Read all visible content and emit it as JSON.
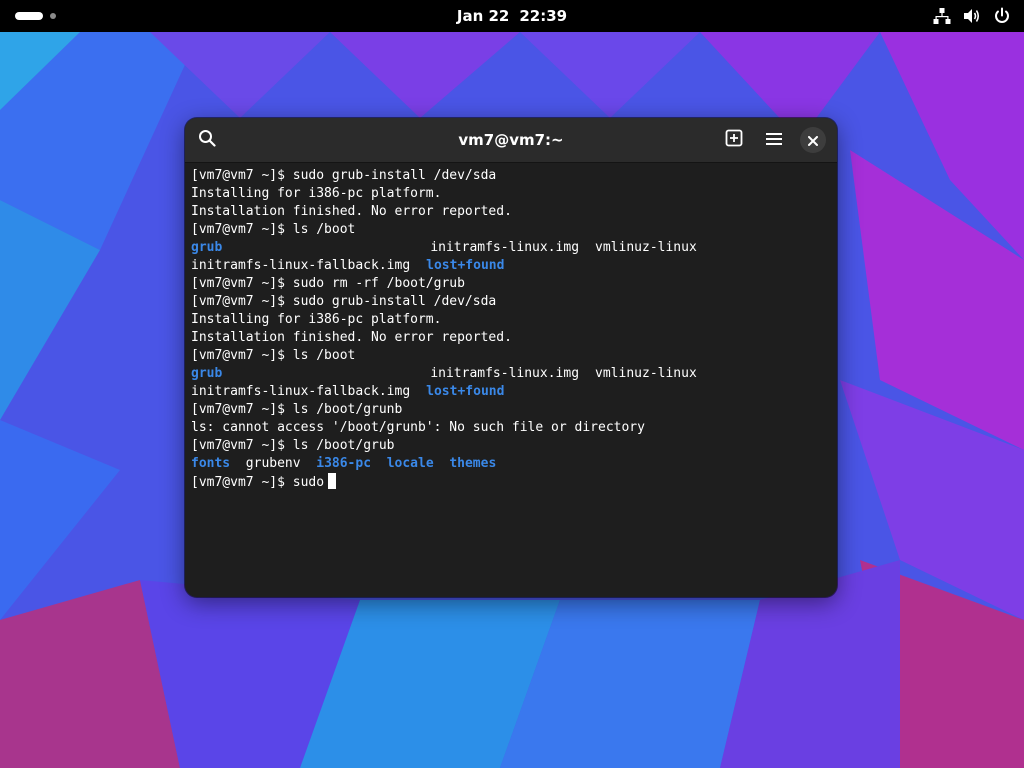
{
  "topbar": {
    "date": "Jan 22",
    "time": "22:39",
    "icons": [
      "activities-indicator",
      "network-icon",
      "volume-icon",
      "power-icon"
    ]
  },
  "terminal": {
    "title": "vm7@vm7:~",
    "colors": {
      "background": "#1e1e1e",
      "titlebar": "#2b2b2b",
      "text": "#ffffff",
      "directory": "#3a88e8"
    },
    "lines": [
      {
        "prompt": "[vm7@vm7 ~]$ ",
        "cmd": "sudo grub-install /dev/sda"
      },
      {
        "text": "Installing for i386-pc platform."
      },
      {
        "text": "Installation finished. No error reported."
      },
      {
        "prompt": "[vm7@vm7 ~]$ ",
        "cmd": "ls /boot"
      },
      {
        "col1": "grub",
        "col2": "initramfs-linux.img",
        "col3": "vmlinuz-linux"
      },
      {
        "col1": "initramfs-linux-fallback.img",
        "col2": "lost+found"
      },
      {
        "prompt": "[vm7@vm7 ~]$ ",
        "cmd": "sudo rm -rf /boot/grub"
      },
      {
        "prompt": "[vm7@vm7 ~]$ ",
        "cmd": "sudo grub-install /dev/sda"
      },
      {
        "text": "Installing for i386-pc platform."
      },
      {
        "text": "Installation finished. No error reported."
      },
      {
        "prompt": "[vm7@vm7 ~]$ ",
        "cmd": "ls /boot"
      },
      {
        "col1": "grub",
        "col2": "initramfs-linux.img",
        "col3": "vmlinuz-linux"
      },
      {
        "col1": "initramfs-linux-fallback.img",
        "col2": "lost+found"
      },
      {
        "prompt": "[vm7@vm7 ~]$ ",
        "cmd": "ls /boot/grunb"
      },
      {
        "text": "ls: cannot access '/boot/grunb': No such file or directory"
      },
      {
        "prompt": "[vm7@vm7 ~]$ ",
        "cmd": "ls /boot/grub"
      },
      {
        "items": [
          "fonts",
          "grubenv",
          "i386-pc",
          "locale",
          "themes"
        ]
      },
      {
        "prompt": "[vm7@vm7 ~]$ ",
        "cmd": "sudo"
      }
    ]
  }
}
